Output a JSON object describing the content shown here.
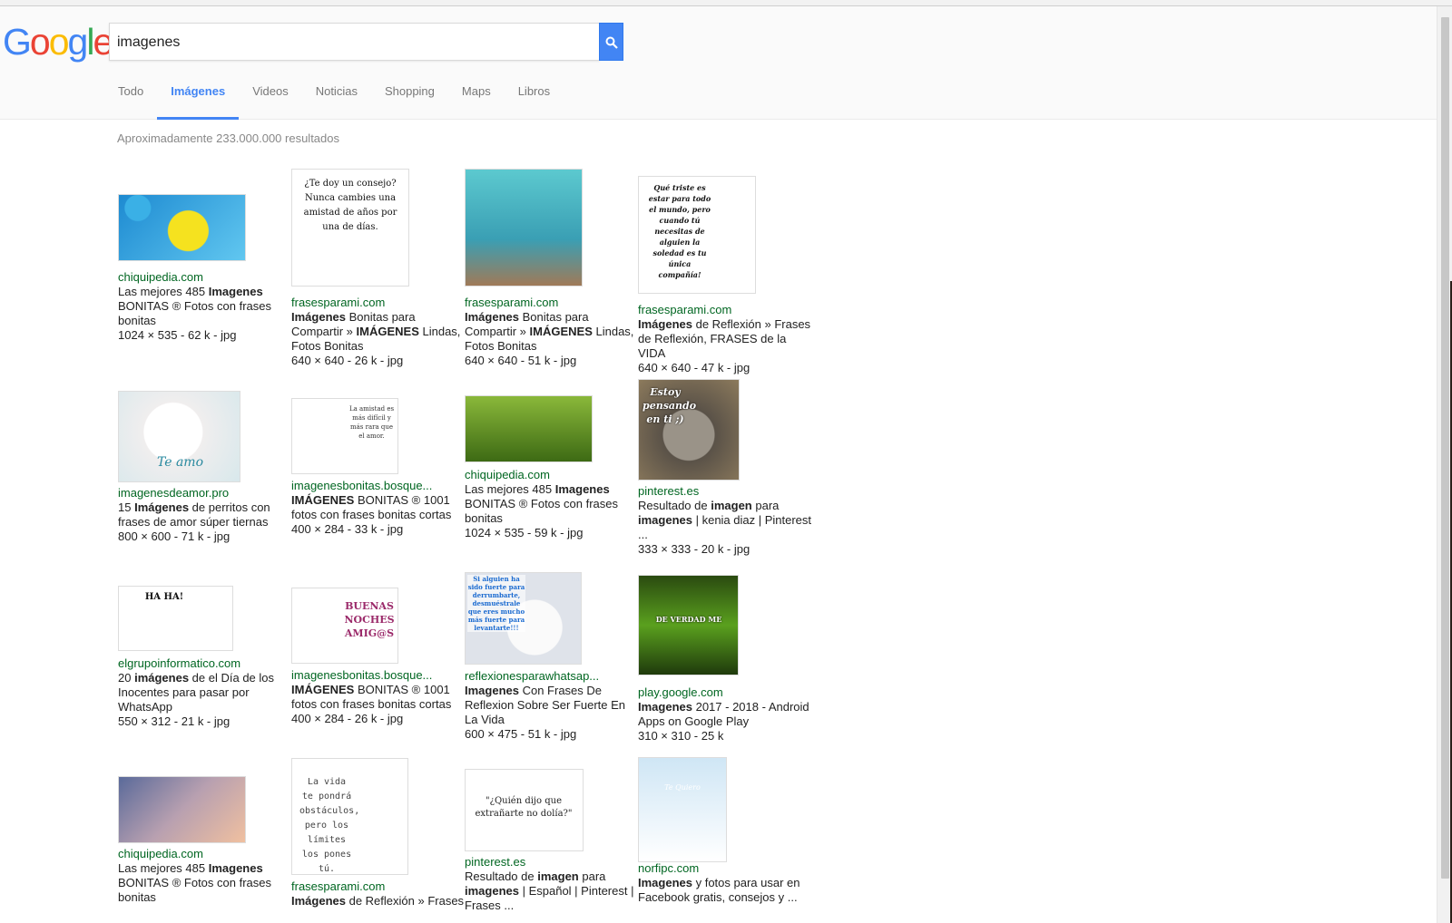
{
  "logo": {
    "letters": [
      "G",
      "o",
      "o",
      "g",
      "l",
      "e"
    ],
    "colors": [
      "#4285f4",
      "#ea4335",
      "#fbbc05",
      "#4285f4",
      "#34a853",
      "#ea4335"
    ]
  },
  "search": {
    "query": "imagenes",
    "button_icon": "search-icon"
  },
  "tabs": [
    "Todo",
    "Imágenes",
    "Videos",
    "Noticias",
    "Shopping",
    "Maps",
    "Libros"
  ],
  "active_tab": "Imágenes",
  "result_stats": "Aproximadamente 233.000.000 resultados",
  "colors": {
    "accent": "#4285f4",
    "source_green": "#006621"
  },
  "results": [
    {
      "source": "chiquipedia.com",
      "title_bold": "",
      "title_html": "Las mejores 485 <b>Imagenes</b> BONITAS ® Fotos con frases bonitas",
      "dims": "1024 × 535 - 62 k - jpg",
      "thumb_text": ""
    },
    {
      "source": "frasesparami.com",
      "title_html": "<b>Imágenes</b> Bonitas para Compartir » <b>IMÁGENES</b> Lindas, Fotos Bonitas",
      "dims": "640 × 640 - 26 k - jpg",
      "thumb_text": "¿Te doy un consejo? Nunca cambies una amistad de años por una de días."
    },
    {
      "source": "frasesparami.com",
      "title_html": "<b>Imágenes</b> Bonitas para Compartir » <b>IMÁGENES</b> Lindas, Fotos Bonitas",
      "dims": "640 × 640 - 51 k - jpg",
      "thumb_text": ""
    },
    {
      "source": "frasesparami.com",
      "title_html": "<b>Imágenes</b> de Reflexión » Frases de Reflexión, FRASES de la VIDA",
      "dims": "640 × 640 - 47 k - jpg",
      "thumb_text": "Qué triste es estar para todo el mundo, pero cuando tú necesitas de alguien la soledad es tu única compañía!"
    },
    {
      "source": "imagenesdeamor.pro",
      "title_html": "15 <b>Imágenes</b> de perritos con frases de amor súper tiernas",
      "dims": "800 × 600 - 71 k - jpg",
      "thumb_text": "Te amo"
    },
    {
      "source": "imagenesbonitas.bosque...",
      "title_html": "<b>IMÁGENES</b> BONITAS ® 1001 fotos con frases bonitas cortas",
      "dims": "400 × 284 - 33 k - jpg",
      "thumb_text": "La amistad es más difícil y más rara que el amor."
    },
    {
      "source": "chiquipedia.com",
      "title_html": "Las mejores 485 <b>Imagenes</b> BONITAS ® Fotos con frases bonitas",
      "dims": "1024 × 535 - 59 k - jpg",
      "thumb_text": ""
    },
    {
      "source": "pinterest.es",
      "title_html": "Resultado de <b>imagen</b> para <b>imagenes</b> | kenia diaz | Pinterest ...",
      "dims": "333 × 333 - 20 k - jpg",
      "thumb_text": "Estoy pensando en ti ;)"
    },
    {
      "source": "elgrupoinformatico.com",
      "title_html": "20 <b>imágenes</b> de el Día de los Inocentes para pasar por WhatsApp",
      "dims": "550 × 312 - 21 k - jpg",
      "thumb_text": "HA HA!"
    },
    {
      "source": "imagenesbonitas.bosque...",
      "title_html": "<b>IMÁGENES</b> BONITAS ® 1001 fotos con frases bonitas cortas",
      "dims": "400 × 284 - 26 k - jpg",
      "thumb_text": "BUENAS NOCHES AMIG@S"
    },
    {
      "source": "reflexionesparawhatsap...",
      "title_html": "<b>Imagenes</b> Con Frases De Reflexion Sobre Ser Fuerte En La Vida",
      "dims": "600 × 475 - 51 k - jpg",
      "thumb_text": "Si alguien ha sido fuerte para derrumbarte, desmuéstrale que eres mucho más fuerte para levantarte!!!"
    },
    {
      "source": "play.google.com",
      "title_html": "<b>Imagenes</b> 2017 - 2018 - Android Apps on Google Play",
      "dims": "310 × 310 - 25 k",
      "thumb_text": "DE VERDAD ME AMAS? O SOLO ME ESTAS COTORREANDO?"
    },
    {
      "source": "chiquipedia.com",
      "title_html": "Las mejores 485 <b>Imagenes</b> BONITAS ® Fotos con frases bonitas",
      "dims": "",
      "thumb_text": ""
    },
    {
      "source": "frasesparami.com",
      "title_html": "<b>Imágenes</b> de Reflexión » Frases",
      "dims": "",
      "thumb_text": "La vida te pondrá obstáculos, pero los límites los pones tú."
    },
    {
      "source": "pinterest.es",
      "title_html": "Resultado de <b>imagen</b> para <b>imagenes</b> | Español | Pinterest | Frases ...",
      "dims": "",
      "thumb_text": "\"¿Quién dijo que extrañarte no dolía?\""
    },
    {
      "source": "norfipc.com",
      "title_html": "<b>Imagenes</b> y fotos para usar en Facebook gratis, consejos y ...",
      "dims": "",
      "thumb_text": "Te Quiero"
    }
  ]
}
